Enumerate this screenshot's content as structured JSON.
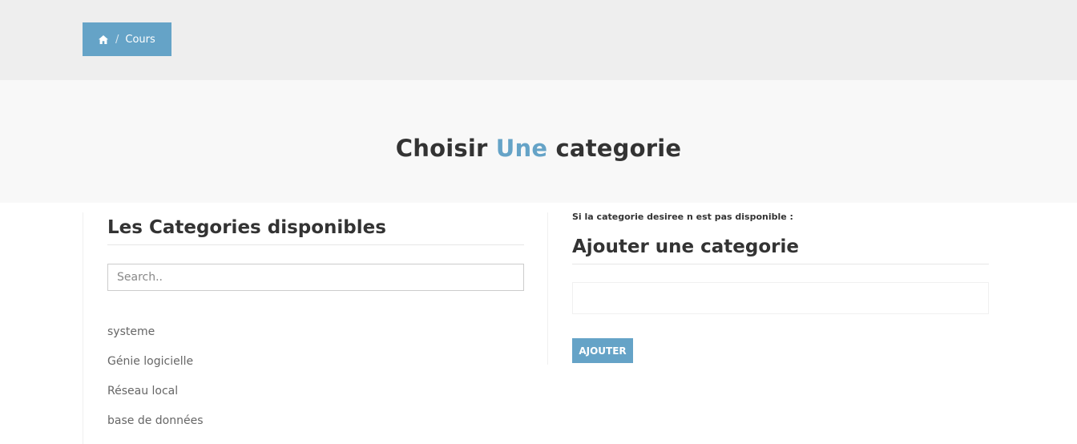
{
  "breadcrumb": {
    "home_icon": "home-icon",
    "separator": "/",
    "current": "Cours"
  },
  "hero": {
    "title_part1": "Choisir",
    "title_accent": "Une",
    "title_part2": "categorie"
  },
  "categories": {
    "title": "Les Categories disponibles",
    "search_placeholder": "Search..",
    "search_value": "",
    "items": [
      "systeme",
      "Génie logicielle",
      "Réseau local",
      "base de données"
    ]
  },
  "add_category": {
    "hint": "Si la categorie desiree n est pas disponible :",
    "title": "Ajouter une categorie",
    "input_value": "",
    "button_label": "AJOUTER"
  },
  "colors": {
    "accent": "#65a3c7",
    "top_bar": "#eeeeee",
    "hero_bg": "#f8f8f8",
    "text": "#333333"
  }
}
